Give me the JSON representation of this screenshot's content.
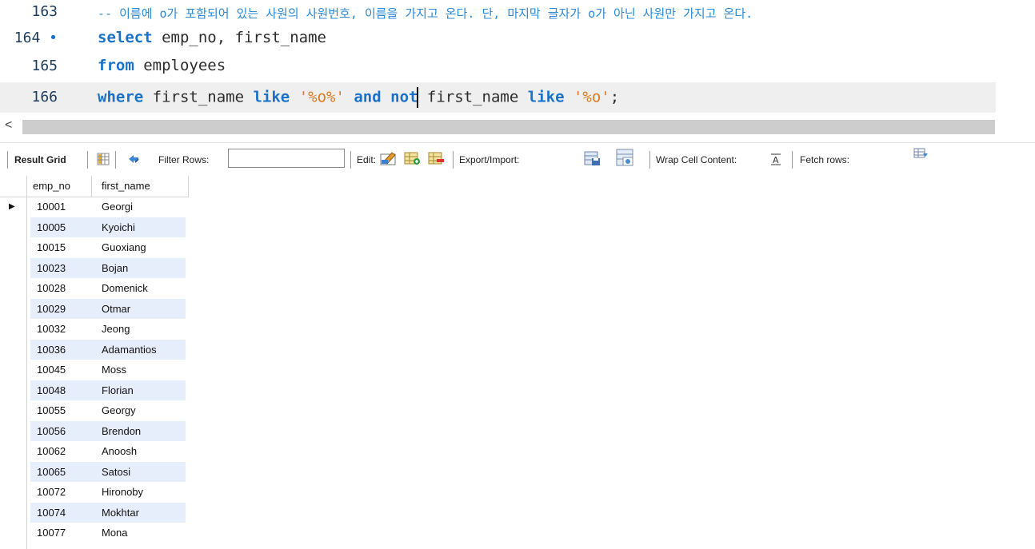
{
  "editor": {
    "lines": [
      {
        "num": "163",
        "marker": "",
        "comment": "-- 이름에 o가 포함되어 있는 사원의 사원번호, 이름을 가지고 온다. 단, 마지막 글자가 o가 아닌 사원만 가지고 온다."
      },
      {
        "num": "164",
        "marker": "•",
        "kw1": "select",
        "rest": " emp_no, first_name"
      },
      {
        "num": "165",
        "marker": "",
        "kw1": "from",
        "rest": " employees"
      },
      {
        "num": "166",
        "marker": "",
        "kw1": "where",
        "t1": " first_name ",
        "kw2": "like",
        "t2": " ",
        "s1": "'%o%'",
        "t3": " ",
        "kw3": "and",
        "t4": " ",
        "kw4": "not",
        "t5": " first_name ",
        "kw5": "like",
        "t6": " ",
        "s2": "'%o'",
        "t7": ";"
      }
    ]
  },
  "scroll": {
    "left_arrow": "<"
  },
  "toolbar": {
    "result_grid": "Result Grid",
    "filter_rows": "Filter Rows:",
    "filter_value": "",
    "edit": "Edit:",
    "export_import": "Export/Import:",
    "wrap_cell": "Wrap Cell Content:",
    "fetch_rows": "Fetch rows:"
  },
  "grid": {
    "columns": [
      "emp_no",
      "first_name"
    ],
    "current_row_marker": "▶",
    "rows": [
      [
        "10001",
        "Georgi"
      ],
      [
        "10005",
        "Kyoichi"
      ],
      [
        "10015",
        "Guoxiang"
      ],
      [
        "10023",
        "Bojan"
      ],
      [
        "10028",
        "Domenick"
      ],
      [
        "10029",
        "Otmar"
      ],
      [
        "10032",
        "Jeong"
      ],
      [
        "10036",
        "Adamantios"
      ],
      [
        "10045",
        "Moss"
      ],
      [
        "10048",
        "Florian"
      ],
      [
        "10055",
        "Georgy"
      ],
      [
        "10056",
        "Brendon"
      ],
      [
        "10062",
        "Anoosh"
      ],
      [
        "10065",
        "Satosi"
      ],
      [
        "10072",
        "Hironoby"
      ],
      [
        "10074",
        "Mokhtar"
      ],
      [
        "10077",
        "Mona"
      ]
    ]
  }
}
